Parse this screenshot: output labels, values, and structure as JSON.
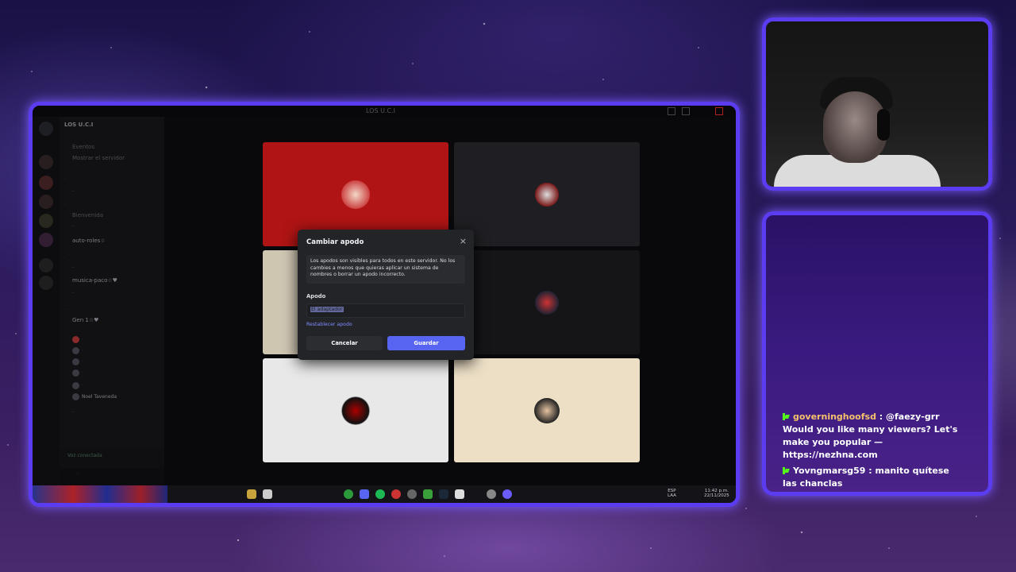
{
  "discord": {
    "server_name": "LOS U.C.I",
    "window_title": "LOS U.C.I",
    "channels": [
      {
        "label": "Eventos"
      },
      {
        "label": "Mostrar el servidor"
      },
      {
        "label": "Bienvenida"
      },
      {
        "label": "auto-roles☆",
        "bright": true
      },
      {
        "label": "musica-paco☆♥",
        "bright": true
      },
      {
        "label": "Gen 1☆♥",
        "bright": true
      }
    ],
    "voice_users": [
      {
        "label": "Noel Taveneda",
        "bright": true
      }
    ],
    "voice_status": "Voz conectada",
    "taskbar": {
      "lang_top": "ESP",
      "lang_bottom": "LAA",
      "time": "11:42 p.m.",
      "date": "22/11/2025"
    }
  },
  "dialog": {
    "title": "Cambiar apodo",
    "close_icon": "×",
    "notice": "Los apodos son visibles para todos en este servidor. No los cambies a menos que quieras aplicar un sistema de nombres o borrar un apodo incorrecto.",
    "field_label": "Apodo",
    "field_value": "El adaptador",
    "reset_link": "Restablecer apodo",
    "cancel_label": "Cancelar",
    "save_label": "Guardar"
  },
  "chat": {
    "messages": [
      {
        "user": "governinghoofsd",
        "sep": " : ",
        "text": "@faezy-grr Would you like many viewers? Let's make you popular — https://nezhna.com"
      },
      {
        "user": "Yovngmarsg59",
        "sep": " : ",
        "text": "manito quítese las chanclas"
      }
    ]
  },
  "colors": {
    "frame_border": "#5b3cf0",
    "discord_blurple": "#5865f2",
    "kick_green": "#53fc18",
    "chat_user1": "#f5c26b"
  },
  "icons": [
    "close-icon",
    "kick-badge-icon",
    "discord-logo-icon",
    "windows-start-icon"
  ]
}
